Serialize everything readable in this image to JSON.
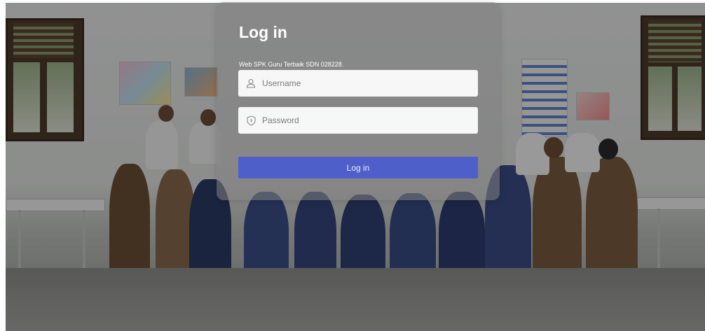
{
  "login": {
    "title": "Log in",
    "subtitle": "Web SPK Guru Terbaik SDN 028228.",
    "username_placeholder": "Username",
    "password_placeholder": "Password",
    "button_label": "Log in",
    "button_color": "#4e5fc9"
  },
  "icons": {
    "username": "user-icon",
    "password": "shield-lock-icon"
  }
}
